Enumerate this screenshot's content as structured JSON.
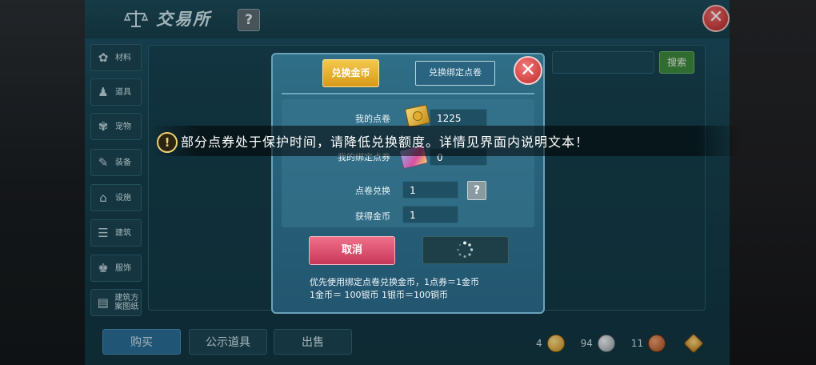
{
  "header": {
    "title": "交易所",
    "help_label": "?",
    "close_label": "✕"
  },
  "sidebar": {
    "items": [
      {
        "label": "材料",
        "icon": "materials-icon",
        "glyph": "✿"
      },
      {
        "label": "道具",
        "icon": "tools-icon",
        "glyph": "♟"
      },
      {
        "label": "宠物",
        "icon": "pet-icon",
        "glyph": "✾"
      },
      {
        "label": "装备",
        "icon": "equipment-icon",
        "glyph": "✎"
      },
      {
        "label": "设施",
        "icon": "facility-icon",
        "glyph": "⌂"
      },
      {
        "label": "建筑",
        "icon": "building-icon",
        "glyph": "☰"
      },
      {
        "label": "服饰",
        "icon": "clothing-icon",
        "glyph": "♚"
      },
      {
        "label": "建筑方案图纸",
        "icon": "blueprint-icon",
        "glyph": "▤"
      }
    ]
  },
  "search": {
    "button_label": "搜索"
  },
  "bottom_tabs": {
    "buy": "购买",
    "public": "公示道具",
    "sell": "出售"
  },
  "currency": {
    "gold": "4",
    "silver": "94",
    "copper": "11"
  },
  "dialog": {
    "tab_active": "兑换金币",
    "tab_inactive": "兑换绑定点卷",
    "close_label": "✕",
    "my_points_label": "我的点卷",
    "my_points_value": "1225",
    "my_bound_points_label": "我的绑定点券",
    "my_bound_points_value": "0",
    "exchange_label": "点卷兑换",
    "exchange_value": "1",
    "gain_label": "获得金币",
    "gain_value": "1",
    "help_label": "?",
    "cancel_label": "取消",
    "footnote_line1": "优先使用绑定点卷兑换金币，1点券＝1金币",
    "footnote_line2": "1金币＝ 100银币  1银币＝100铜币"
  },
  "notice": {
    "icon_label": "!",
    "text": "部分点券处于保护时间，请降低兑换额度。详情见界面内说明文本！"
  }
}
